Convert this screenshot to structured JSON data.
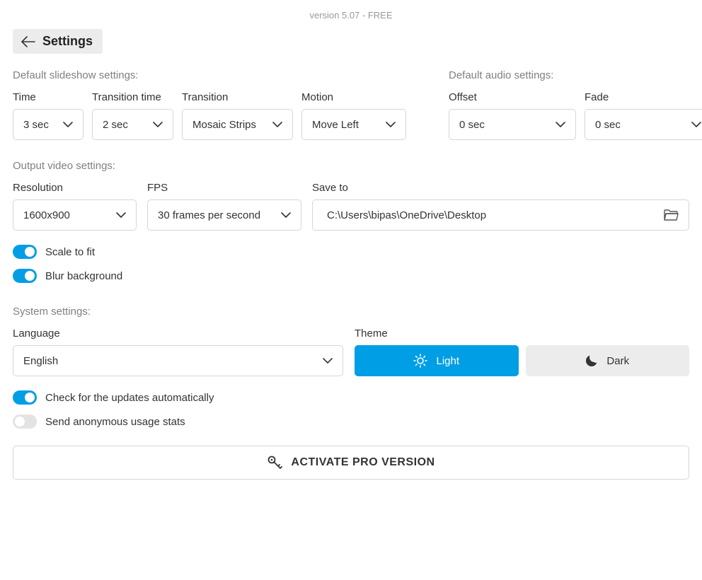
{
  "version_text": "version 5.07 - FREE",
  "page_title": "Settings",
  "slideshow": {
    "header": "Default slideshow settings:",
    "time_label": "Time",
    "time_value": "3 sec",
    "transition_time_label": "Transition time",
    "transition_time_value": "2 sec",
    "transition_label": "Transition",
    "transition_value": "Mosaic Strips",
    "motion_label": "Motion",
    "motion_value": "Move Left"
  },
  "audio": {
    "header": "Default audio settings:",
    "offset_label": "Offset",
    "offset_value": "0 sec",
    "fade_label": "Fade",
    "fade_value": "0 sec"
  },
  "output": {
    "header": "Output video settings:",
    "resolution_label": "Resolution",
    "resolution_value": "1600x900",
    "fps_label": "FPS",
    "fps_value": "30 frames per second",
    "save_to_label": "Save to",
    "save_to_value": "C:\\Users\\bipas\\OneDrive\\Desktop",
    "scale_to_fit_label": "Scale to fit",
    "blur_background_label": "Blur background"
  },
  "system": {
    "header": "System settings:",
    "language_label": "Language",
    "language_value": "English",
    "theme_label": "Theme",
    "theme_light": "Light",
    "theme_dark": "Dark",
    "check_updates_label": "Check for the updates automatically",
    "anon_stats_label": "Send anonymous usage stats"
  },
  "activate_label": "ACTIVATE PRO VERSION"
}
